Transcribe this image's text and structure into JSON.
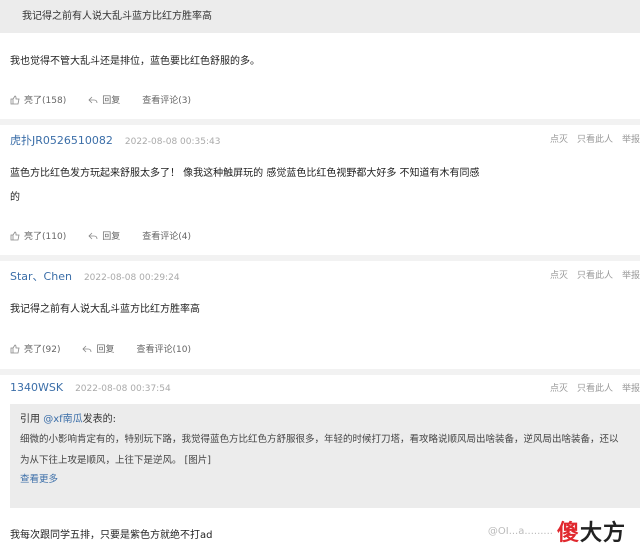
{
  "top_quote": {
    "text": "我记得之前有人说大乱斗蓝方比红方胜率高"
  },
  "posts": [
    {
      "body": "我也觉得不管大乱斗还是排位，蓝色要比红色舒服的多。",
      "like": "亮了(158)",
      "reply": "回复",
      "comments": "查看评论(3)"
    },
    {
      "user": "虎扑JR0526510082",
      "time": "2022-08-08 00:35:43",
      "body_line1": "蓝色方比红色发方玩起来舒服太多了！ 像我这种触屏玩的 感觉蓝色比红色视野都大好多 不知道有木有同感",
      "body_line2": "的",
      "like": "亮了(110)",
      "reply": "回复",
      "comments": "查看评论(4)"
    },
    {
      "user": "Star、Chen",
      "time": "2022-08-08 00:29:24",
      "body": "我记得之前有人说大乱斗蓝方比红方胜率高",
      "like": "亮了(92)",
      "reply": "回复",
      "comments": "查看评论(10)"
    },
    {
      "user": "1340WSK",
      "time": "2022-08-08 00:37:54",
      "quote_prefix": "引用 ",
      "quote_user": "@xf南瓜",
      "quote_suffix": "发表的:",
      "quote_text": "细微的小影响肯定有的，特别玩下路，我觉得蓝色方比红色方舒服很多，年轻的时候打刀塔，看攻略说顺风局出啥装备，逆风局出啥装备，还以为从下往上攻是顺风，上往下是逆风。 [图片]",
      "quote_more": "查看更多",
      "body": "我每次跟同学五排，只要是紫色方就绝不打ad"
    }
  ],
  "post_actions": {
    "dislike": "点灭",
    "only_this": "只看此人",
    "report": "举报"
  },
  "watermark": {
    "site": "@OI...a.........",
    "logo_red": "傻",
    "logo_black": "大方"
  }
}
